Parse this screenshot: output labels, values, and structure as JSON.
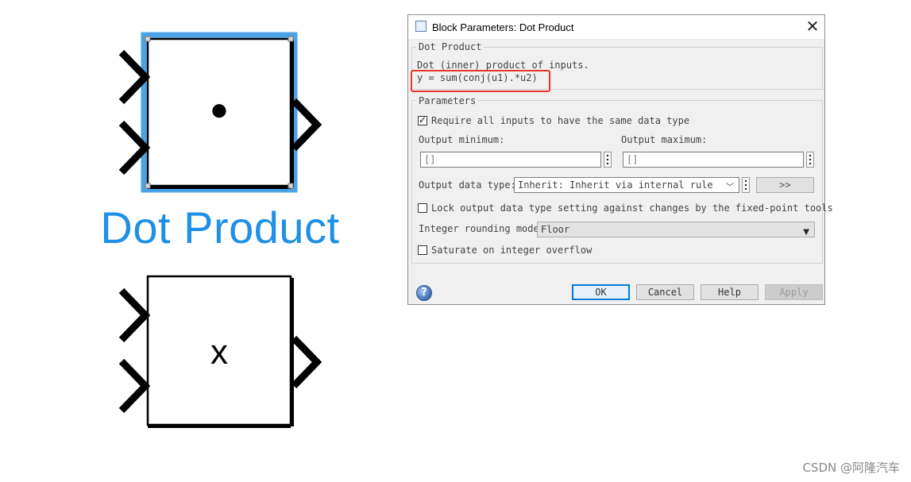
{
  "blocks": {
    "dot_product": {
      "symbol": "●",
      "label": "Dot Product"
    },
    "product": {
      "symbol": "x"
    }
  },
  "dialog": {
    "title": "Block Parameters: Dot Product",
    "close_icon": "close-icon",
    "description_group": {
      "legend": "Dot Product",
      "line1": "Dot (inner) product of inputs.",
      "line2": "y = sum(conj(u1).*u2)"
    },
    "parameters_group": {
      "legend": "Parameters",
      "require_same_type": {
        "label": "Require all inputs to have the same data type",
        "checked": true
      },
      "output_minimum": {
        "label": "Output minimum:",
        "value": "[]"
      },
      "output_maximum": {
        "label": "Output maximum:",
        "value": "[]"
      },
      "output_data_type": {
        "label": "Output data type:",
        "value": "Inherit: Inherit via internal rule",
        "assistant_label": ">>"
      },
      "lock_output_type": {
        "label": "Lock output data type setting against changes by the fixed-point tools",
        "checked": false
      },
      "rounding_mode": {
        "label": "Integer rounding mode:",
        "value": "Floor"
      },
      "saturate_overflow": {
        "label": "Saturate on integer overflow",
        "checked": false
      }
    },
    "buttons": {
      "ok": "OK",
      "cancel": "Cancel",
      "help": "Help",
      "apply": "Apply"
    },
    "help_icon": "?"
  },
  "colors": {
    "selection_blue": "#4aa3e6",
    "label_blue": "#1e90e6",
    "highlight_red": "#e8352f"
  },
  "watermark": "CSDN @阿隆汽车"
}
